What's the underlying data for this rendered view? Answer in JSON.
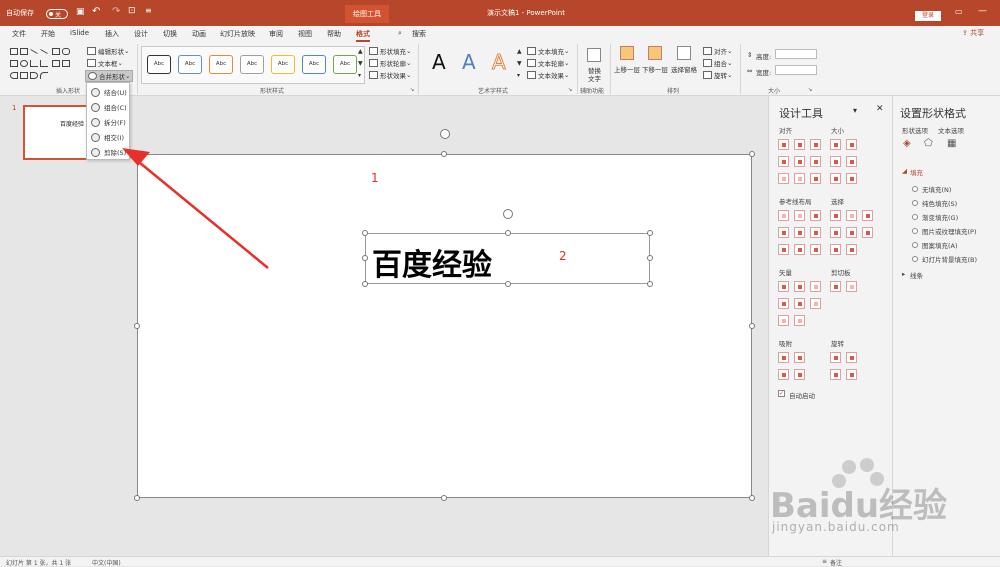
{
  "titlebar": {
    "autosave": "自动保存",
    "autosave_state": "关",
    "drawing_tools": "绘图工具",
    "doc_title": "演示文稿1 - PowerPoint",
    "login": "登录"
  },
  "tabs": [
    "文件",
    "开始",
    "iSlide",
    "插入",
    "设计",
    "切换",
    "动画",
    "幻灯片放映",
    "审阅",
    "视图",
    "帮助",
    "格式"
  ],
  "active_tab": "格式",
  "search": "搜索",
  "share": "共享",
  "ribbon": {
    "insert_shapes": {
      "label": "插入形状",
      "edit_shape": "编辑形状",
      "textbox": "文本框",
      "merge_shapes": "合并形状"
    },
    "shape_styles": {
      "label": "形状样式",
      "abc": "Abc",
      "fill": "形状填充",
      "outline": "形状轮廓",
      "effects": "形状效果"
    },
    "wordart": {
      "label": "艺术字样式",
      "glyph": "A",
      "text_fill": "文本填充",
      "text_outline": "文本轮廓",
      "text_effects": "文本效果"
    },
    "accessibility": {
      "label": "辅助功能",
      "alt_text_l1": "替换",
      "alt_text_l2": "文字"
    },
    "arrange": {
      "label": "排列",
      "bring_forward": "上移一层",
      "send_backward": "下移一层",
      "selection_pane": "选择窗格",
      "align": "对齐",
      "group": "组合",
      "rotate": "旋转"
    },
    "size": {
      "label": "大小",
      "height": "高度:",
      "width": "宽度:"
    }
  },
  "merge_menu": [
    "结合(U)",
    "组合(C)",
    "拆分(F)",
    "相交(I)",
    "剪除(S)"
  ],
  "thumbnail": {
    "number": "1",
    "text": "百度经验"
  },
  "slide": {
    "text": "百度经验",
    "label1": "1",
    "label2": "2"
  },
  "design_tools": {
    "title": "设计工具",
    "sections": {
      "align": "对齐",
      "size": "大小",
      "guides": "参考线布局",
      "select": "选择",
      "vector": "矢量",
      "clipboard": "剪切板",
      "snap": "吸附",
      "rotate": "旋转"
    },
    "auto_start": "自动启动"
  },
  "format_pane": {
    "title": "设置形状格式",
    "tab1": "形状选项",
    "tab2": "文本选项",
    "fill_header": "填充",
    "fill_options": [
      "无填充(N)",
      "纯色填充(S)",
      "渐变填充(G)",
      "图片或纹理填充(P)",
      "图案填充(A)",
      "幻灯片背景填充(B)"
    ],
    "line_header": "线条"
  },
  "statusbar": {
    "slide_info": "幻灯片 第 1 张，共 1 张",
    "lang": "中文(中国)",
    "notes": "备注"
  },
  "watermark": {
    "logo": "Baidu经验",
    "url": "jingyan.baidu.com"
  },
  "colors": {
    "accent": "#b7472a",
    "arrow": "#e8302a"
  }
}
